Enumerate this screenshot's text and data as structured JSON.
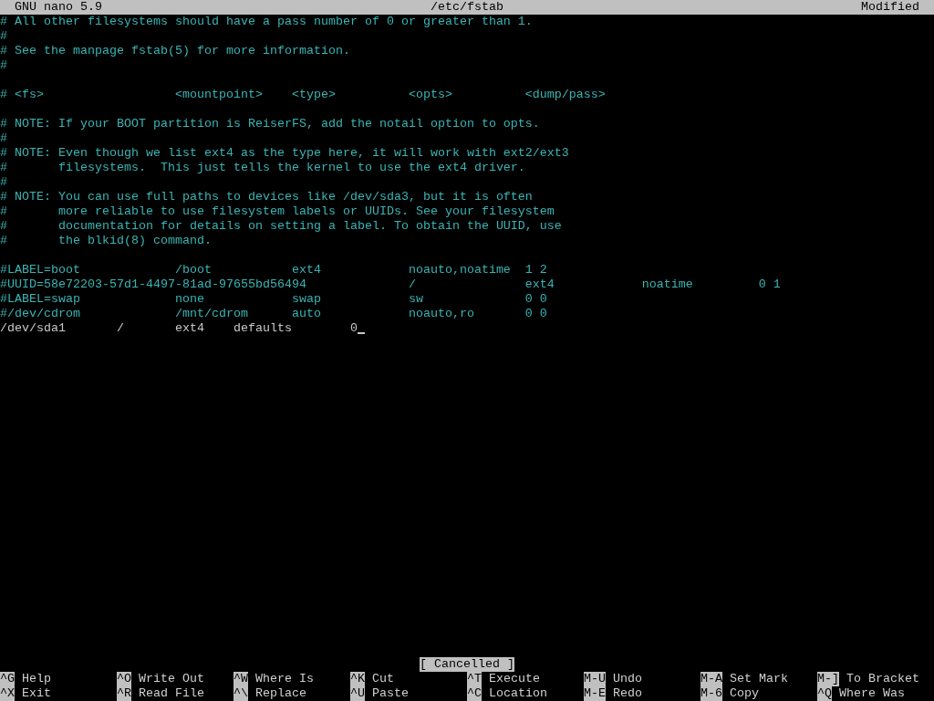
{
  "title_bar": {
    "app": "GNU nano 5.9",
    "file": "/etc/fstab",
    "status": "Modified"
  },
  "lines": [
    {
      "kind": "comment",
      "text": "# All other filesystems should have a pass number of 0 or greater than 1."
    },
    {
      "kind": "comment",
      "text": "#"
    },
    {
      "kind": "comment",
      "text": "# See the manpage fstab(5) for more information."
    },
    {
      "kind": "comment",
      "text": "#"
    },
    {
      "kind": "blank"
    },
    {
      "kind": "comment",
      "text": "# <fs>                  <mountpoint>    <type>          <opts>          <dump/pass>"
    },
    {
      "kind": "blank"
    },
    {
      "kind": "comment",
      "text": "# NOTE: If your BOOT partition is ReiserFS, add the notail option to opts."
    },
    {
      "kind": "comment",
      "text": "#"
    },
    {
      "kind": "comment",
      "text": "# NOTE: Even though we list ext4 as the type here, it will work with ext2/ext3"
    },
    {
      "kind": "comment",
      "text": "#       filesystems.  This just tells the kernel to use the ext4 driver."
    },
    {
      "kind": "comment",
      "text": "#"
    },
    {
      "kind": "comment",
      "text": "# NOTE: You can use full paths to devices like /dev/sda3, but it is often"
    },
    {
      "kind": "comment",
      "text": "#       more reliable to use filesystem labels or UUIDs. See your filesystem"
    },
    {
      "kind": "comment",
      "text": "#       documentation for details on setting a label. To obtain the UUID, use"
    },
    {
      "kind": "comment",
      "text": "#       the blkid(8) command."
    },
    {
      "kind": "blank"
    },
    {
      "kind": "comment",
      "text": "#LABEL=boot             /boot           ext4            noauto,noatime  1 2"
    },
    {
      "kind": "comment",
      "text": "#UUID=58e72203-57d1-4497-81ad-97655bd56494              /               ext4            noatime         0 1"
    },
    {
      "kind": "comment",
      "text": "#LABEL=swap             none            swap            sw              0 0"
    },
    {
      "kind": "comment",
      "text": "#/dev/cdrom             /mnt/cdrom      auto            noauto,ro       0 0"
    },
    {
      "kind": "plain",
      "text": "/dev/sda1       /       ext4    defaults        0",
      "cursor": true
    }
  ],
  "status_message": "[ Cancelled ]",
  "shortcuts": [
    [
      {
        "key": "^G",
        "label": "Help"
      },
      {
        "key": "^O",
        "label": "Write Out"
      },
      {
        "key": "^W",
        "label": "Where Is"
      },
      {
        "key": "^K",
        "label": "Cut"
      },
      {
        "key": "^T",
        "label": "Execute"
      },
      {
        "key": "M-U",
        "label": "Undo"
      },
      {
        "key": "M-A",
        "label": "Set Mark"
      },
      {
        "key": "M-]",
        "label": "To Bracket"
      }
    ],
    [
      {
        "key": "^X",
        "label": "Exit"
      },
      {
        "key": "^R",
        "label": "Read File"
      },
      {
        "key": "^\\",
        "label": "Replace"
      },
      {
        "key": "^U",
        "label": "Paste"
      },
      {
        "key": "^C",
        "label": "Location"
      },
      {
        "key": "M-E",
        "label": "Redo"
      },
      {
        "key": "M-6",
        "label": "Copy"
      },
      {
        "key": "^Q",
        "label": "Where Was"
      }
    ]
  ]
}
